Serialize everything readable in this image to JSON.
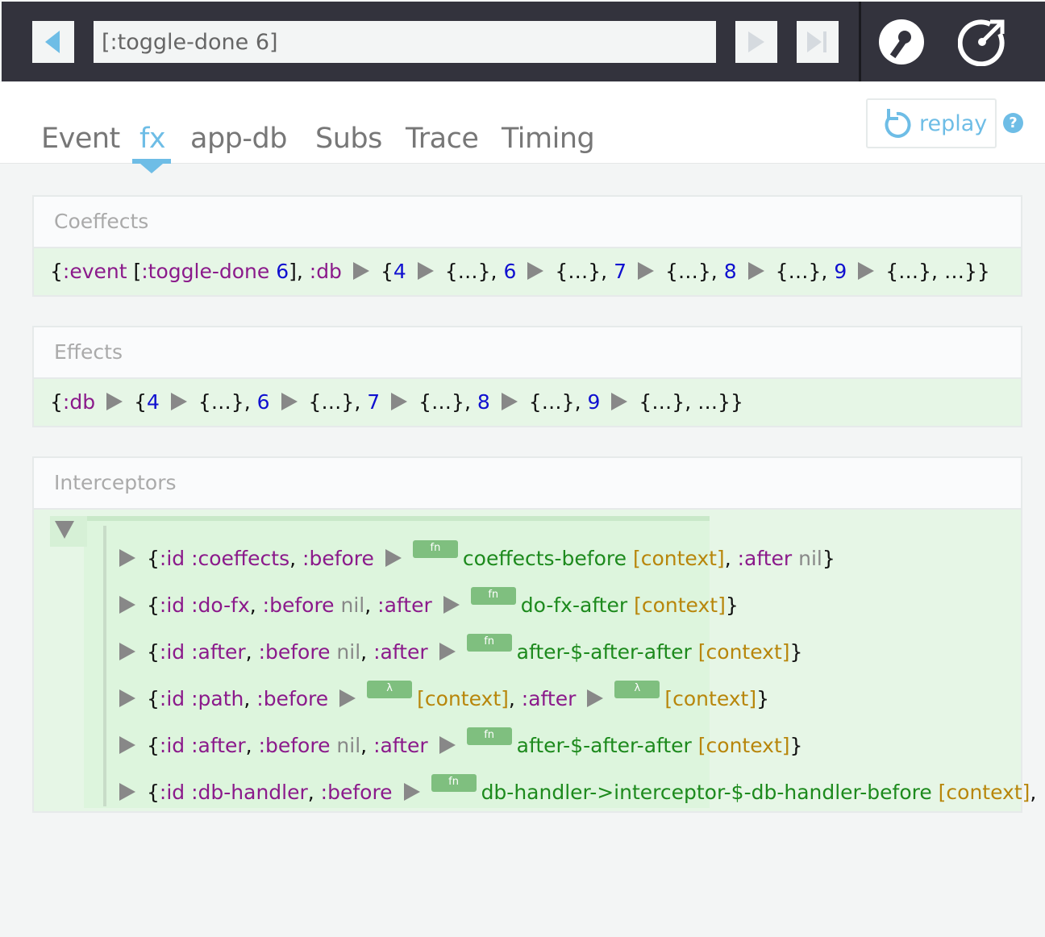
{
  "toolbar": {
    "event_input": "[:toggle-done 6]",
    "colors": {
      "bar": "#33333d",
      "accent": "#6ebde6"
    },
    "icons": [
      "back-arrow",
      "play",
      "skip-to-end",
      "wrench",
      "external-link"
    ]
  },
  "tabs": [
    {
      "label": "Event"
    },
    {
      "label": "fx",
      "active": true
    },
    {
      "label": "app-db"
    },
    {
      "label": "Subs"
    },
    {
      "label": "Trace"
    },
    {
      "label": "Timing"
    }
  ],
  "replay_label": "replay",
  "help_label": "?",
  "coeffects": {
    "title": "Coeffects",
    "tokens": [
      [
        "p",
        "{"
      ],
      [
        "k",
        ":event"
      ],
      [
        "p",
        " ["
      ],
      [
        "k",
        ":toggle-done"
      ],
      [
        "p",
        " "
      ],
      [
        "n",
        "6"
      ],
      [
        "p",
        "], "
      ],
      [
        "k",
        ":db"
      ],
      [
        "arr",
        ""
      ],
      [
        "p",
        "{"
      ],
      [
        "n",
        "4"
      ],
      [
        "arr",
        ""
      ],
      [
        "p",
        "{…}, "
      ],
      [
        "n",
        "6"
      ],
      [
        "arr",
        ""
      ],
      [
        "p",
        "{…}, "
      ],
      [
        "n",
        "7"
      ],
      [
        "arr",
        ""
      ],
      [
        "p",
        "{…}, "
      ],
      [
        "n",
        "8"
      ],
      [
        "arr",
        ""
      ],
      [
        "p",
        "{…}, "
      ],
      [
        "n",
        "9"
      ],
      [
        "arr",
        ""
      ],
      [
        "p",
        "{…}, …}}"
      ]
    ]
  },
  "effects": {
    "title": "Effects",
    "tokens": [
      [
        "p",
        "{"
      ],
      [
        "k",
        ":db"
      ],
      [
        "arr",
        ""
      ],
      [
        "p",
        "{"
      ],
      [
        "n",
        "4"
      ],
      [
        "arr",
        ""
      ],
      [
        "p",
        "{…}, "
      ],
      [
        "n",
        "6"
      ],
      [
        "arr",
        ""
      ],
      [
        "p",
        "{…}, "
      ],
      [
        "n",
        "7"
      ],
      [
        "arr",
        ""
      ],
      [
        "p",
        "{…}, "
      ],
      [
        "n",
        "8"
      ],
      [
        "arr",
        ""
      ],
      [
        "p",
        "{…}, "
      ],
      [
        "n",
        "9"
      ],
      [
        "arr",
        ""
      ],
      [
        "p",
        "{…}, …}}"
      ]
    ]
  },
  "interceptors": {
    "title": "Interceptors",
    "rows": [
      [
        [
          "arr",
          ""
        ],
        [
          "p",
          "{"
        ],
        [
          "k",
          ":id :coeffects"
        ],
        [
          "p",
          ", "
        ],
        [
          "k",
          ":before"
        ],
        [
          "arr",
          ""
        ],
        [
          "badge",
          "fn"
        ],
        [
          "g",
          "coeffects-before"
        ],
        [
          "c",
          " [context]"
        ],
        [
          "p",
          ", "
        ],
        [
          "k",
          ":after"
        ],
        [
          "nil",
          " nil"
        ],
        [
          "p",
          "}"
        ]
      ],
      [
        [
          "arr",
          ""
        ],
        [
          "p",
          "{"
        ],
        [
          "k",
          ":id :do-fx"
        ],
        [
          "p",
          ", "
        ],
        [
          "k",
          ":before"
        ],
        [
          "nil",
          " nil"
        ],
        [
          "p",
          ", "
        ],
        [
          "k",
          ":after"
        ],
        [
          "arr",
          ""
        ],
        [
          "badge",
          "fn"
        ],
        [
          "g",
          "do-fx-after"
        ],
        [
          "c",
          " [context]"
        ],
        [
          "p",
          "}"
        ]
      ],
      [
        [
          "arr",
          ""
        ],
        [
          "p",
          "{"
        ],
        [
          "k",
          ":id :after"
        ],
        [
          "p",
          ", "
        ],
        [
          "k",
          ":before"
        ],
        [
          "nil",
          " nil"
        ],
        [
          "p",
          ", "
        ],
        [
          "k",
          ":after"
        ],
        [
          "arr",
          ""
        ],
        [
          "badge",
          "fn"
        ],
        [
          "g",
          "after-$-after-after"
        ],
        [
          "c",
          " [context]"
        ],
        [
          "p",
          "}"
        ]
      ],
      [
        [
          "arr",
          ""
        ],
        [
          "p",
          "{"
        ],
        [
          "k",
          ":id :path"
        ],
        [
          "p",
          ", "
        ],
        [
          "k",
          ":before"
        ],
        [
          "arr",
          ""
        ],
        [
          "badge",
          "λ"
        ],
        [
          "c",
          "[context]"
        ],
        [
          "p",
          ", "
        ],
        [
          "k",
          ":after"
        ],
        [
          "arr",
          ""
        ],
        [
          "badge",
          "λ"
        ],
        [
          "c",
          "[context]"
        ],
        [
          "p",
          "}"
        ]
      ],
      [
        [
          "arr",
          ""
        ],
        [
          "p",
          "{"
        ],
        [
          "k",
          ":id :after"
        ],
        [
          "p",
          ", "
        ],
        [
          "k",
          ":before"
        ],
        [
          "nil",
          " nil"
        ],
        [
          "p",
          ", "
        ],
        [
          "k",
          ":after"
        ],
        [
          "arr",
          ""
        ],
        [
          "badge",
          "fn"
        ],
        [
          "g",
          "after-$-after-after"
        ],
        [
          "c",
          " [context]"
        ],
        [
          "p",
          "}"
        ]
      ],
      [
        [
          "arr",
          ""
        ],
        [
          "p",
          "{"
        ],
        [
          "k",
          ":id :db-handler"
        ],
        [
          "p",
          ", "
        ],
        [
          "k",
          ":before"
        ],
        [
          "arr",
          ""
        ],
        [
          "badge",
          "fn"
        ],
        [
          "g",
          "db-handler->interceptor-$-db-handler-before"
        ],
        [
          "c",
          " [context]"
        ],
        [
          "p",
          ","
        ]
      ]
    ]
  }
}
